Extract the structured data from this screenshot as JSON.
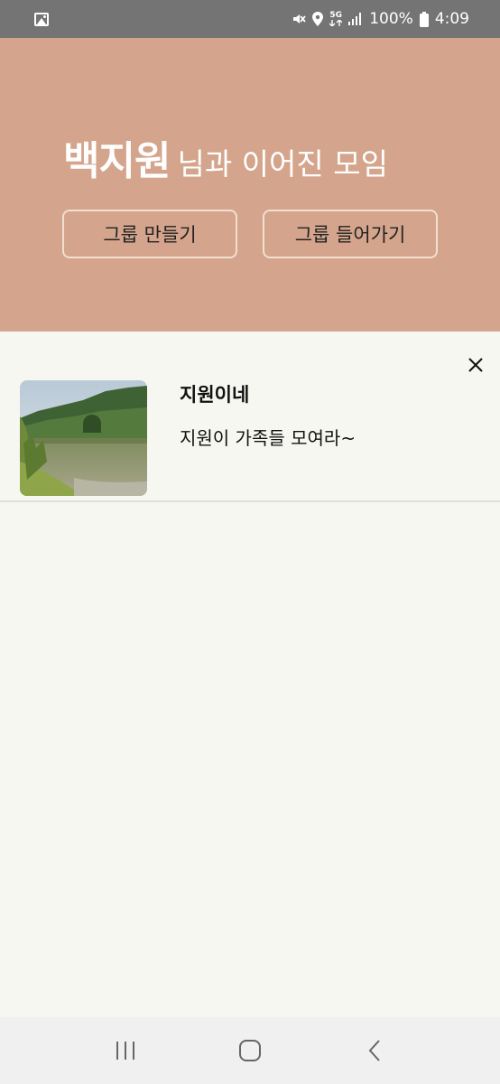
{
  "status_bar": {
    "battery_text": "100%",
    "time": "4:09",
    "network": "5G",
    "icons": [
      "gallery-icon",
      "mute-icon",
      "location-icon",
      "5g-icon",
      "signal-icon",
      "battery-icon"
    ]
  },
  "header": {
    "name": "백지원",
    "title_suffix": "님과 이어진 모임",
    "create_button": "그룹 만들기",
    "join_button": "그룹 들어가기",
    "background_color": "#d4a58c"
  },
  "groups": [
    {
      "title": "지원이네",
      "description": "지원이 가족들 모여라~",
      "thumbnail": "lake-mountain-photo"
    }
  ],
  "nav_bar": {
    "icons": [
      "recent-apps-icon",
      "home-icon",
      "back-icon"
    ]
  }
}
